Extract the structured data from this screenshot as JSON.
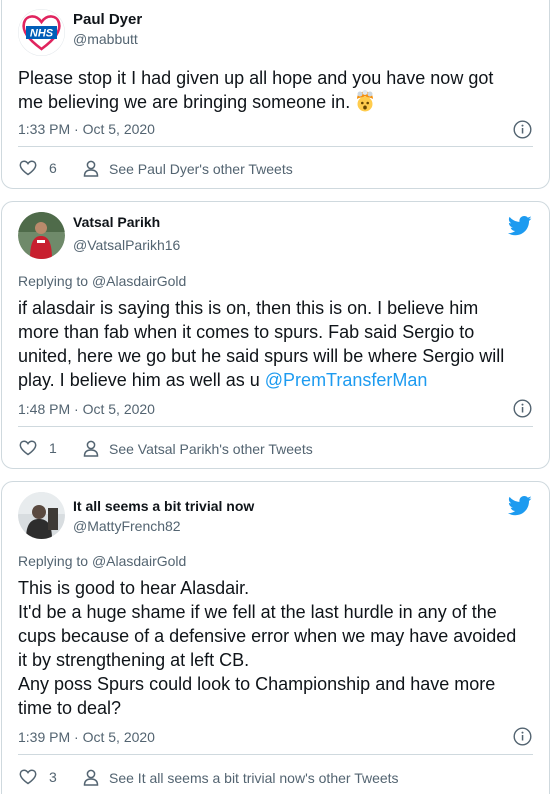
{
  "tweets": [
    {
      "name": "Paul Dyer",
      "handle": "@mabbutt",
      "avatar_text": "NHS",
      "lines": [
        "Please stop it I had given up all hope and you have now got",
        "me believing we are bringing someone in."
      ],
      "emoji": "exploding-head",
      "time": "1:33 PM · Oct 5, 2020",
      "likes": "6",
      "other_label": "See Paul Dyer's other Tweets"
    },
    {
      "name": "Vatsal Parikh",
      "handle": "@VatsalParikh16",
      "replying_prefix": "Replying to",
      "replying_to": "@AlasdairGold",
      "lines": [
        "if alasdair is saying this is on, then this is on. I believe him",
        "more than fab when it comes to spurs. Fab said Sergio to",
        "united, here we go but he said spurs  will be where Sergio will",
        "play. I believe him as well as u "
      ],
      "mention": "@PremTransferMan",
      "time": "1:48 PM · Oct 5, 2020",
      "likes": "1",
      "other_label": "See Vatsal Parikh's other Tweets"
    },
    {
      "name": "It all seems a bit trivial now",
      "handle": "@MattyFrench82",
      "replying_prefix": "Replying to",
      "replying_to": "@AlasdairGold",
      "lines": [
        "This is good to hear Alasdair.",
        "It'd be a huge shame if we fell at the last hurdle in any of the",
        "cups because of a defensive error when we may have avoided",
        "it by strengthening at left CB.",
        "Any poss Spurs could look to Championship and have more",
        "time to deal?"
      ],
      "time": "1:39 PM · Oct 5, 2020",
      "likes": "3",
      "other_label": "See It all seems a bit trivial now's other Tweets"
    }
  ],
  "colors": {
    "link": "#1d9bf0",
    "secondary_text": "#536471",
    "border": "#cfd9de",
    "nhs_blue": "#005eb8",
    "heart_red": "#e0245e"
  },
  "icons": [
    "twitter-bird-icon",
    "info-icon",
    "heart-icon",
    "person-icon",
    "exploding-head-emoji"
  ]
}
